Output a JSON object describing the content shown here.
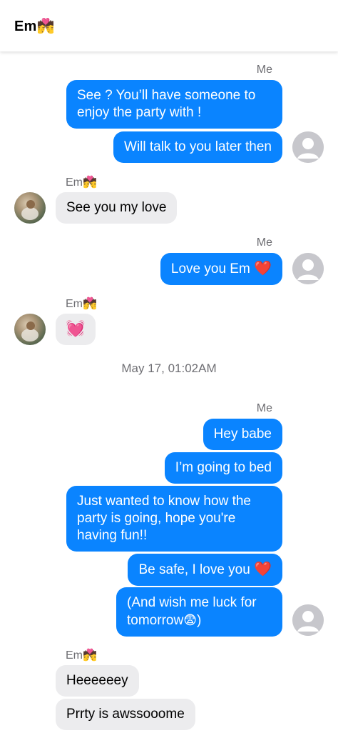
{
  "header": {
    "title": "Em💏"
  },
  "labels": {
    "me": "Me",
    "em": "Em💏"
  },
  "timestamp": "May 17, 01:02AM",
  "messages": {
    "m1": "See ? You’ll have someone to enjoy the party with !",
    "m2": "Will talk to you later then",
    "m3": "See you my love",
    "m4_text": "Love you Em",
    "m4_emoji": "❤️",
    "m5_emoji": "💓",
    "m6": "Hey babe",
    "m7": "I’m going to bed",
    "m8": "Just wanted to know how the party is going, hope you're having fun!!",
    "m9_text": "Be safe, I love you",
    "m9_emoji": "❤️",
    "m10_line1": "(And wish me luck for",
    "m10_line2_text": "tomorrow",
    "m10_line2_emoji": "😨",
    "m10_line2_end": ")",
    "m11": "Heeeeeey",
    "m12": "Prrty is awssooome"
  },
  "colors": {
    "outgoing_bubble": "#0a84ff",
    "incoming_bubble": "#ececee",
    "secondary_text": "#6e6e73"
  },
  "icons": {
    "my_avatar": "default-person-avatar-icon",
    "em_avatar": "profile-photo-avatar"
  }
}
